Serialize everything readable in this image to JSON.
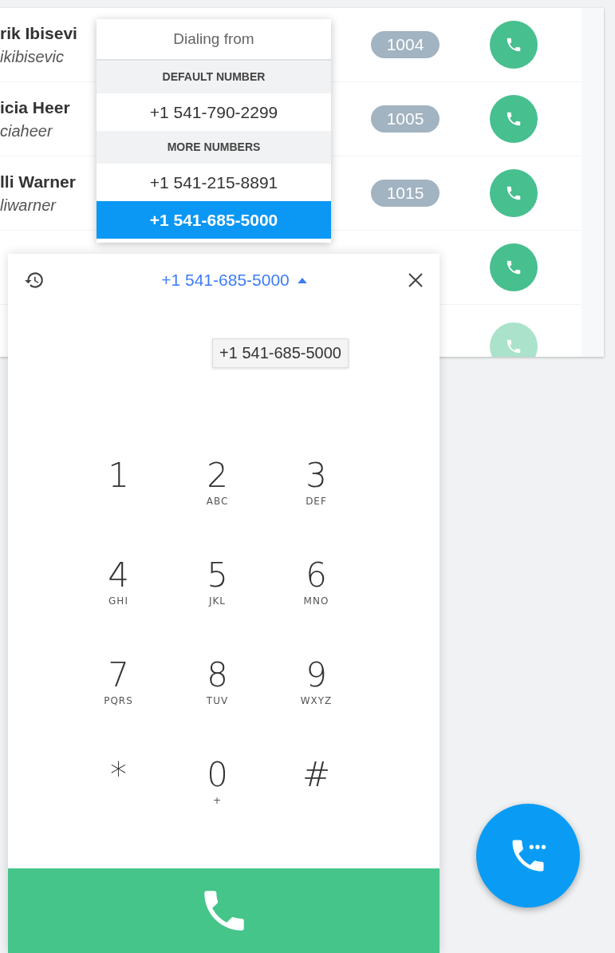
{
  "contacts": [
    {
      "kind": "full",
      "name": "rik Ibisevi",
      "handle": "ikibisevic",
      "extension": "1004"
    },
    {
      "kind": "full",
      "name": "icia Heer",
      "handle": "ciaheer",
      "extension": "1005"
    },
    {
      "kind": "full",
      "name": "lli Warner",
      "handle": "liwarner",
      "extension": "1015"
    },
    {
      "kind": "partial"
    },
    {
      "kind": "faded"
    }
  ],
  "dialing_menu": {
    "title": "Dialing from",
    "sections": [
      {
        "header": "DEFAULT NUMBER",
        "numbers": [
          {
            "number": "+1 541-790-2299",
            "selected": false
          }
        ]
      },
      {
        "header": "MORE NUMBERS",
        "numbers": [
          {
            "number": "+1 541-215-8891",
            "selected": false
          },
          {
            "number": "+1 541-685-5000",
            "selected": true
          }
        ]
      }
    ]
  },
  "dialer": {
    "caller_id": "+1 541-685-5000",
    "expanded": true,
    "tooltip": "+1 541-685-5000",
    "keys": [
      {
        "digit": "1"
      },
      {
        "digit": "2",
        "letters": "ABC"
      },
      {
        "digit": "3",
        "letters": "DEF"
      },
      {
        "digit": "4",
        "letters": "GHI"
      },
      {
        "digit": "5",
        "letters": "JKL"
      },
      {
        "digit": "6",
        "letters": "MNO"
      },
      {
        "digit": "7",
        "letters": "PQRS"
      },
      {
        "digit": "8",
        "letters": "TUV"
      },
      {
        "digit": "9",
        "letters": "WXYZ"
      },
      {
        "digit": "*"
      },
      {
        "digit": "0",
        "letters": "+"
      },
      {
        "digit": "#"
      }
    ]
  }
}
